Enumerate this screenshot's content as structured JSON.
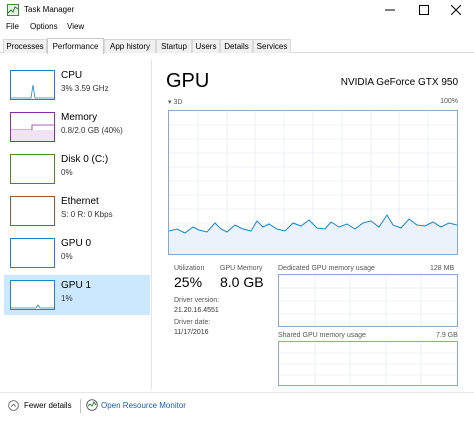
{
  "window": {
    "title": "Task Manager"
  },
  "menu": [
    "File",
    "Options",
    "View"
  ],
  "tabs": [
    "Processes",
    "Performance",
    "App history",
    "Startup",
    "Users",
    "Details",
    "Services"
  ],
  "active_tab": "Performance",
  "sidebar": [
    {
      "name": "CPU",
      "detail": "3%  3.59 GHz",
      "color": "#1a86c8"
    },
    {
      "name": "Memory",
      "detail": "0.8/2.0 GB (40%)",
      "color": "#8b2fa8"
    },
    {
      "name": "Disk 0 (C:)",
      "detail": "0%",
      "color": "#4d8a1f"
    },
    {
      "name": "Ethernet",
      "detail": "S: 0  R: 0 Kbps",
      "color": "#a0522d"
    },
    {
      "name": "GPU 0",
      "detail": "0%",
      "color": "#1a86c8"
    },
    {
      "name": "GPU 1",
      "detail": "1%",
      "color": "#1a86c8",
      "selected": true
    }
  ],
  "main": {
    "title": "GPU",
    "model": "NVIDIA GeForce GTX 950",
    "graph_label": "3D",
    "graph_max": "100%",
    "utilization_label": "Utilization",
    "utilization_value": "25%",
    "gpu_memory_label": "GPU Memory",
    "gpu_memory_value": "8.0 GB",
    "driver_version_label": "Driver version:",
    "driver_version_value": "21.20.16.4551",
    "driver_date_label": "Driver date:",
    "driver_date_value": "11/17/2016",
    "dedicated_label": "Dedicated GPU memory usage",
    "dedicated_max": "128 MB",
    "shared_label": "Shared GPU memory usage",
    "shared_max": "7.9 GB"
  },
  "footer": {
    "fewer_details": "Fewer details",
    "open_monitor": "Open Resource Monitor"
  },
  "colors": {
    "accent": "#1a86c8",
    "selected_bg": "#cce8ff",
    "graph_border": "#8aa8c8",
    "link": "#1a5fb4"
  }
}
